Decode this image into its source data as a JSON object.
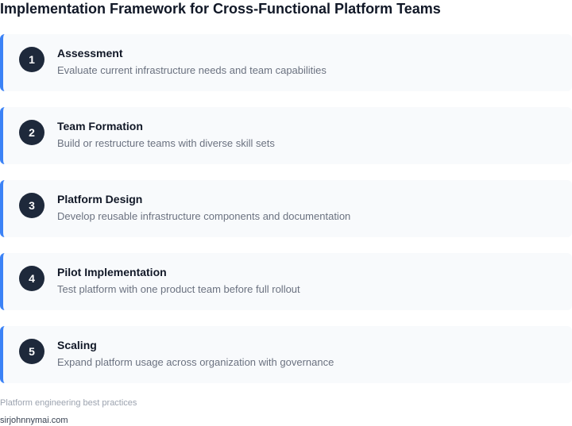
{
  "page": {
    "title": "Implementation Framework for Cross-Functional Platform Teams"
  },
  "steps": [
    {
      "number": "1",
      "title": "Assessment",
      "description": "Evaluate current infrastructure needs and team capabilities"
    },
    {
      "number": "2",
      "title": "Team Formation",
      "description": "Build or restructure teams with diverse skill sets"
    },
    {
      "number": "3",
      "title": "Platform Design",
      "description": "Develop reusable infrastructure components and documentation"
    },
    {
      "number": "4",
      "title": "Pilot Implementation",
      "description": "Test platform with one product team before full rollout"
    },
    {
      "number": "5",
      "title": "Scaling",
      "description": "Expand platform usage across organization with governance"
    }
  ],
  "footer": {
    "note": "Platform engineering best practices",
    "site": "sirjohnnymai.com"
  },
  "colors": {
    "accent": "#3b82f6",
    "badge": "#1e293b",
    "card_background": "#f8fafc"
  }
}
